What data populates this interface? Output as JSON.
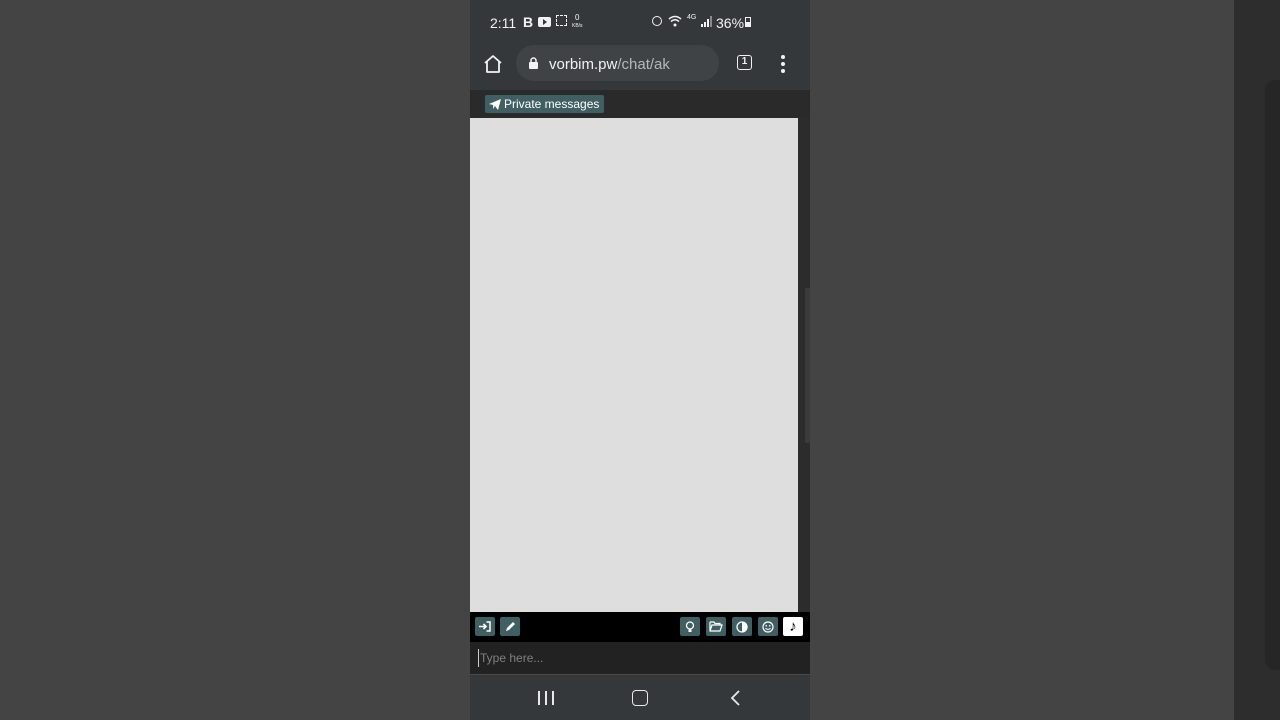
{
  "status_bar": {
    "time": "2:11",
    "b_icon": "B",
    "kb_speed": "0",
    "kb_unit": "KB/s",
    "network": "4G",
    "battery": "36%"
  },
  "browser": {
    "url_domain": "vorbim.pw",
    "url_path": "/chat/ak",
    "tab_count": "1"
  },
  "page": {
    "private_messages_label": "Private messages",
    "input_placeholder": "Type here...",
    "toolbar_left": [
      "login-icon",
      "pencil-icon"
    ],
    "toolbar_right": [
      "lightbulb-icon",
      "folder-open-icon",
      "contrast-icon",
      "smiley-icon",
      "music-note-icon"
    ],
    "music_note_glyph": "♪"
  },
  "colors": {
    "accent_button": "#3f5f63",
    "chat_background": "#dedede",
    "page_background": "#444444",
    "browser_chrome": "#35383a"
  }
}
